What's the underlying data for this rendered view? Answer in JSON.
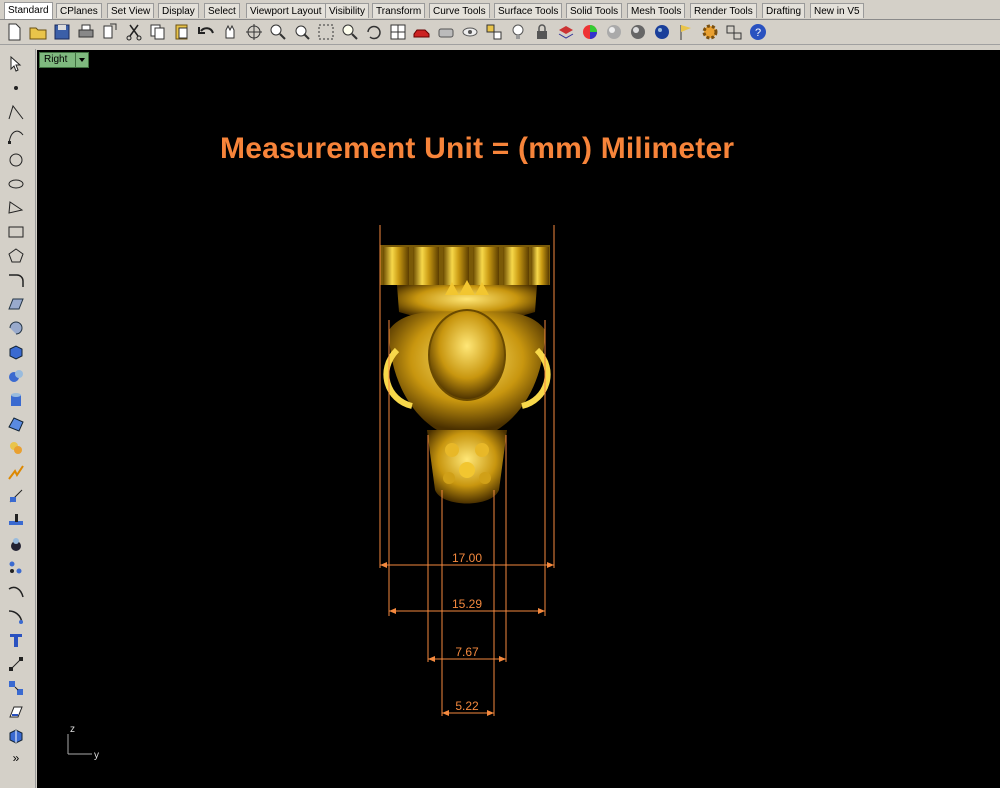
{
  "tabs": [
    "Standard",
    "CPlanes",
    "Set View",
    "Display",
    "Select",
    "Viewport Layout",
    "Visibility",
    "Transform",
    "Curve Tools",
    "Surface Tools",
    "Solid Tools",
    "Mesh Tools",
    "Render Tools",
    "Drafting",
    "New in V5"
  ],
  "toolbar_icons": [
    "new-icon",
    "open-icon",
    "save-icon",
    "print-icon",
    "import-icon",
    "cut-icon",
    "copy-icon",
    "paste-icon",
    "undo-icon",
    "pan-icon",
    "rotate-view-icon",
    "zoom-icon",
    "zoom-window-icon",
    "zoom-selected-icon",
    "zoom-extents-icon",
    "viewport-icon",
    "car-icon",
    "camera-icon",
    "visibility-icon",
    "point-icon",
    "light-icon",
    "lock-icon",
    "layer-icon",
    "color-wheel-icon",
    "sphere-shaded-icon",
    "sphere-render-icon",
    "sphere-blue-icon",
    "flag-icon",
    "gear-icon",
    "grid-icon",
    "help-icon"
  ],
  "sidebar_icons": [
    "select-arrow-icon",
    "point-icon",
    "polyline-icon",
    "curve-icon",
    "circle-icon",
    "ellipse-icon",
    "arc-icon",
    "rectangle-icon",
    "polygon-icon",
    "fillet-icon",
    "surface-icon",
    "revolve-icon",
    "box-icon",
    "sphere-icon",
    "cylinder-icon",
    "mesh-icon",
    "boolean-icon",
    "explode-icon",
    "trim-icon",
    "split-icon",
    "group-icon",
    "array-icon",
    "blend-icon",
    "extend-icon",
    "text-icon",
    "dimension-icon",
    "transform-icon",
    "analyze-icon",
    "render-icon",
    "more-icon"
  ],
  "viewport": {
    "name": "Right",
    "heading": "Measurement Unit = (mm) Milimeter",
    "axis_z": "z",
    "axis_y": "y"
  },
  "dimensions": [
    {
      "label": "17.00",
      "value": 17.0
    },
    {
      "label": "15.29",
      "value": 15.29
    },
    {
      "label": "7.67",
      "value": 7.67
    },
    {
      "label": "5.22",
      "value": 5.22
    }
  ],
  "colors": {
    "viewport_bg": "#000000",
    "dimension": "#f4893e",
    "heading": "#f7843a",
    "gold": "#d8b020"
  }
}
